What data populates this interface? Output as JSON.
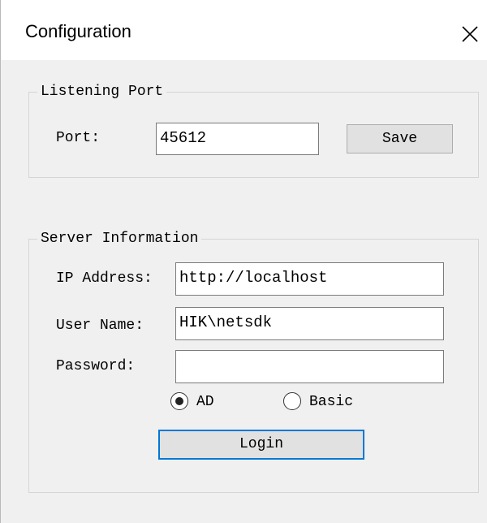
{
  "window": {
    "title": "Configuration",
    "close_icon": "close-icon"
  },
  "listening_port": {
    "legend": "Listening Port",
    "port_label": "Port:",
    "port_value": "45612",
    "save_label": "Save"
  },
  "server_information": {
    "legend": "Server Information",
    "ip_label": "IP Address:",
    "ip_value": "http://localhost",
    "user_label": "User Name:",
    "user_value": "HIK\\netsdk",
    "password_label": "Password:",
    "password_value": "",
    "auth_options": [
      {
        "label": "AD",
        "selected": true
      },
      {
        "label": "Basic",
        "selected": false
      }
    ],
    "login_label": "Login"
  },
  "colors": {
    "accent": "#0078d7",
    "dialog_bg": "#f0f0f0",
    "button_bg": "#e1e1e1"
  }
}
